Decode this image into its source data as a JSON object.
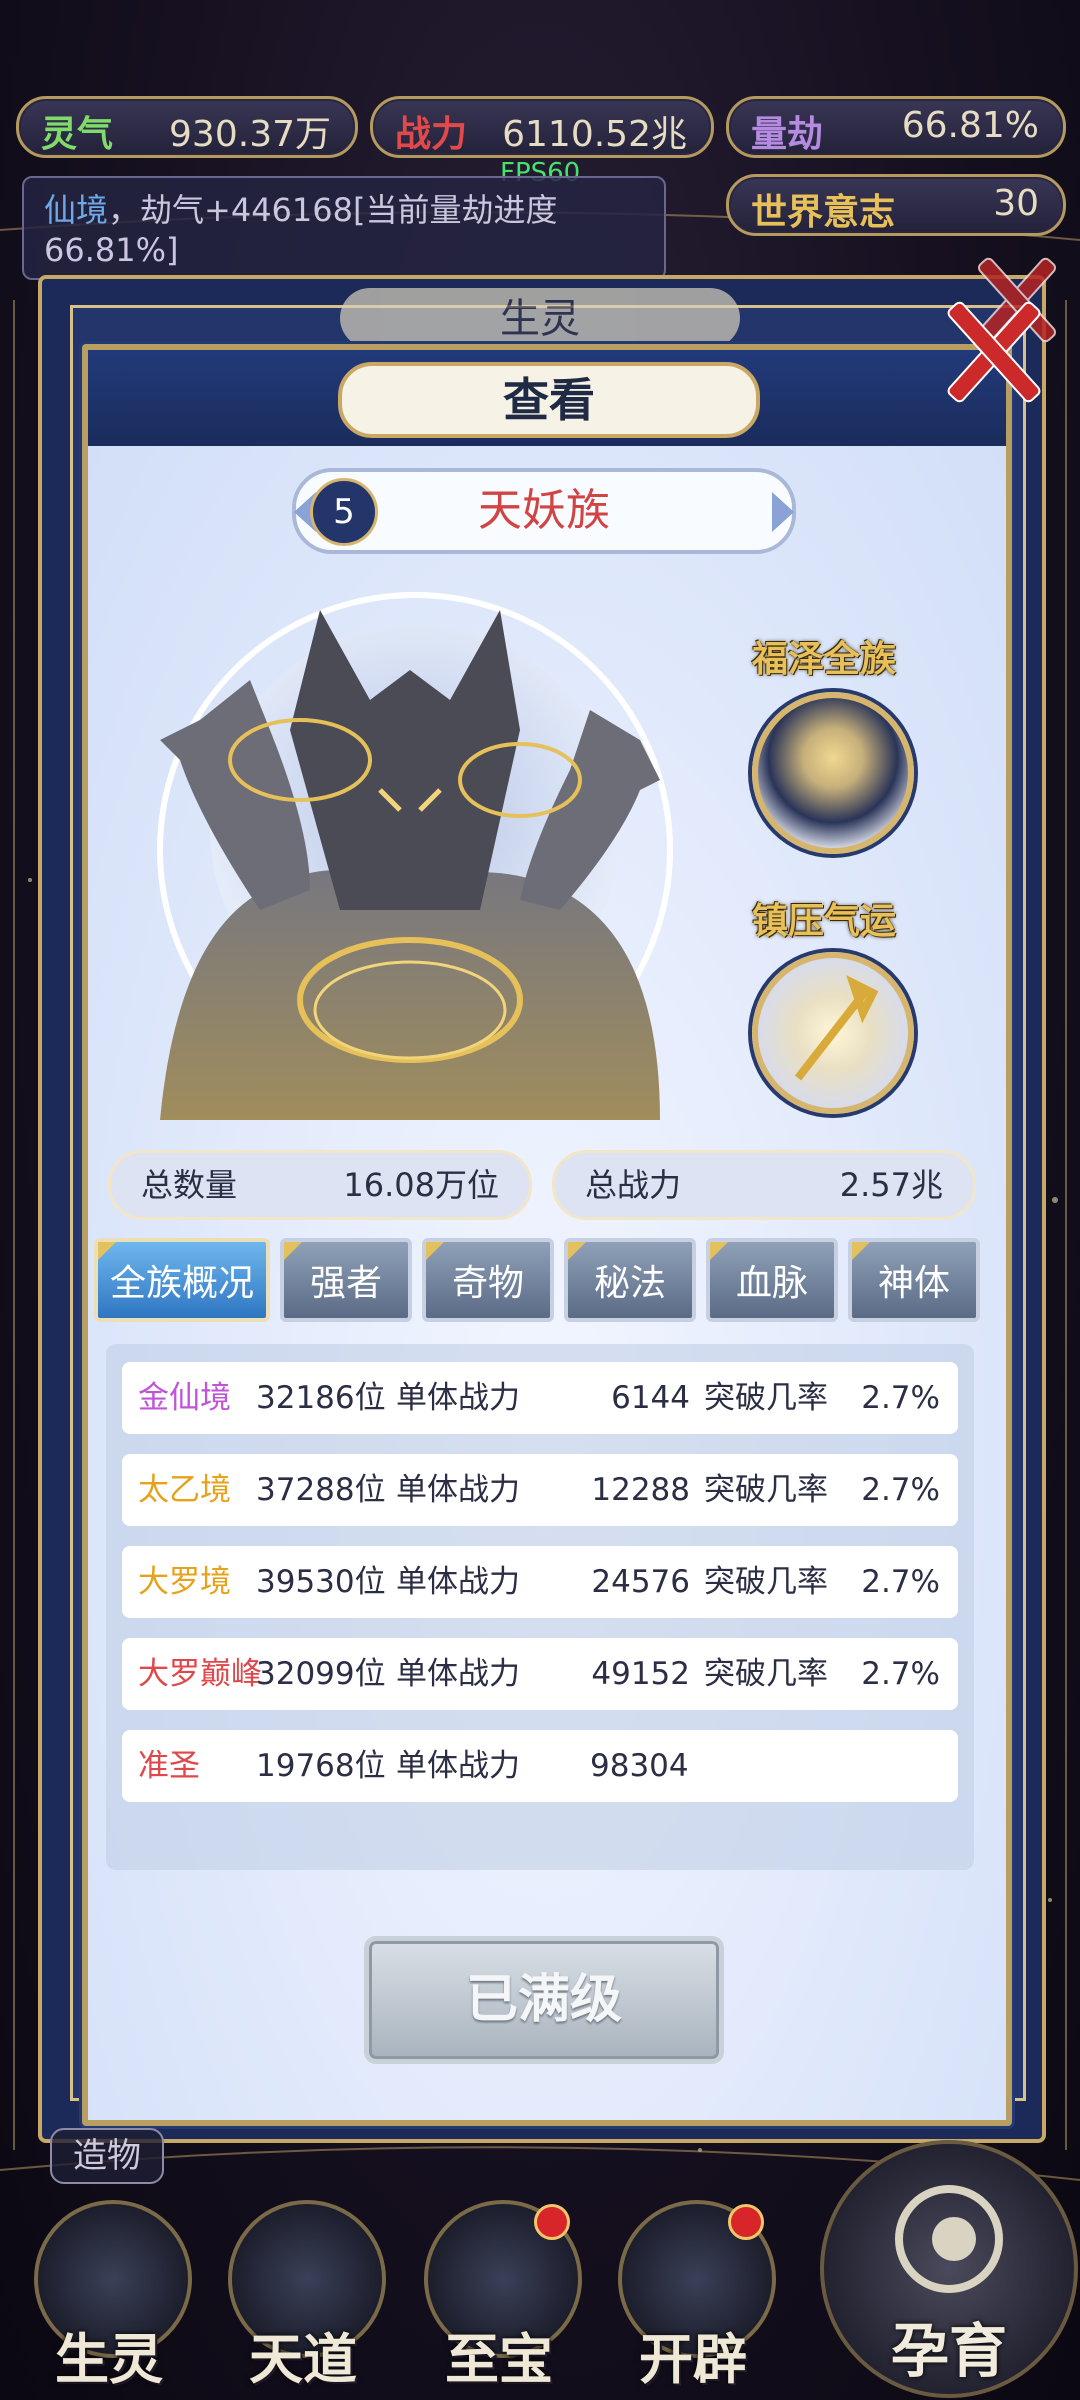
{
  "top_bar": {
    "lingqi": {
      "label": "灵气",
      "value": "930.37万",
      "color": "#7fdc6a"
    },
    "zhanli": {
      "label": "战力",
      "value": "6110.52兆",
      "color": "#e24a4a"
    },
    "liangjie": {
      "label": "量劫",
      "value": "66.81%",
      "color": "#b58be2"
    },
    "shijie": {
      "label": "世界意志",
      "value": "30",
      "color": "#e7c05a"
    }
  },
  "fps": "FPS60",
  "notice": {
    "line1_prefix": "仙境",
    "line1_rest": "，劫气+446168[当前量劫进度",
    "line2": "66.81%]"
  },
  "back_panel_title": "生灵",
  "dialog": {
    "title": "查看"
  },
  "race": {
    "index": "5",
    "name": "天妖族"
  },
  "blessings": [
    {
      "label": "福泽全族",
      "icon": "moon-sphere-icon"
    },
    {
      "label": "镇压气运",
      "icon": "golden-spear-icon"
    }
  ],
  "stats": {
    "total_count_label": "总数量",
    "total_count_value": "16.08万位",
    "total_power_label": "总战力",
    "total_power_value": "2.57兆"
  },
  "tabs": [
    {
      "label": "全族概况",
      "active": true
    },
    {
      "label": "强者",
      "active": false
    },
    {
      "label": "奇物",
      "active": false
    },
    {
      "label": "秘法",
      "active": false
    },
    {
      "label": "血脉",
      "active": false
    },
    {
      "label": "神体",
      "active": false
    }
  ],
  "realms": [
    {
      "name": "金仙境",
      "color": "#c153d8",
      "count": "32186位",
      "power_label": "单体战力",
      "power": "6144",
      "break_label": "突破几率",
      "break_rate": "2.7%"
    },
    {
      "name": "太乙境",
      "color": "#e5a21a",
      "count": "37288位",
      "power_label": "单体战力",
      "power": "12288",
      "break_label": "突破几率",
      "break_rate": "2.7%"
    },
    {
      "name": "大罗境",
      "color": "#e5a21a",
      "count": "39530位",
      "power_label": "单体战力",
      "power": "24576",
      "break_label": "突破几率",
      "break_rate": "2.7%"
    },
    {
      "name": "大罗巅峰",
      "color": "#e0464a",
      "count": "32099位",
      "power_label": "单体战力",
      "power": "49152",
      "break_label": "突破几率",
      "break_rate": "2.7%"
    },
    {
      "name": "准圣",
      "color": "#e0464a",
      "count": "19768位",
      "power_label": "单体战力",
      "power": "98304",
      "break_label": "",
      "break_rate": ""
    }
  ],
  "max_button": "已满级",
  "create_tag": "造物",
  "bottom_nav": [
    {
      "label": "生灵",
      "badge": false
    },
    {
      "label": "天道",
      "badge": false
    },
    {
      "label": "至宝",
      "badge": true
    },
    {
      "label": "开辟",
      "badge": true
    }
  ],
  "breed_button": "孕育"
}
